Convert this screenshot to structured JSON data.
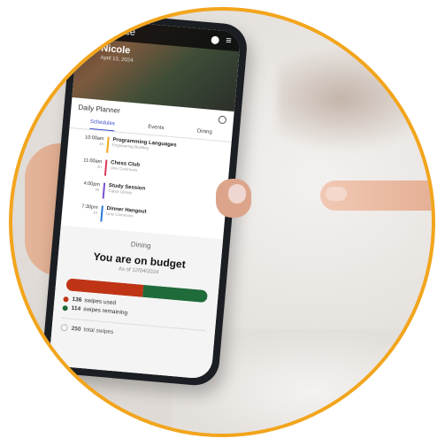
{
  "hero": {
    "title": "Glance",
    "name": "Nicole",
    "date": "April 13, 2024"
  },
  "planner": {
    "title": "Daily Planner",
    "tabs": [
      "Schedules",
      "Events",
      "Dining"
    ],
    "active_tab": 0,
    "events": [
      {
        "time": "10:00am",
        "duration": "1h",
        "title": "Programming Languages",
        "location": "Engineering Building",
        "color": "#f2a51c"
      },
      {
        "time": "11:00am",
        "duration": "1h",
        "title": "Chess Club",
        "location": "Univ Commons",
        "color": "#d9395a"
      },
      {
        "time": "4:00pm",
        "duration": "3h",
        "title": "Study Session",
        "location": "Cabot Library",
        "color": "#7b4fd1"
      },
      {
        "time": "7:30pm",
        "duration": "1h",
        "title": "Dinner Hangout",
        "location": "Univ Commons",
        "color": "#2a7bd6"
      }
    ]
  },
  "dining": {
    "label": "Dining",
    "status": "You are on budget",
    "as_of": "As of 12/04/2024",
    "used_value": 136,
    "used_label": "136",
    "used_text": "swipes used",
    "remaining_value": 114,
    "remaining_label": "114",
    "remaining_text": "swipes remaining",
    "total_label": "250",
    "total_text": "total swipes",
    "colors": {
      "used": "#bf3415",
      "remaining": "#1f6b3a"
    }
  },
  "frame": {
    "accent": "#f2a51c"
  }
}
